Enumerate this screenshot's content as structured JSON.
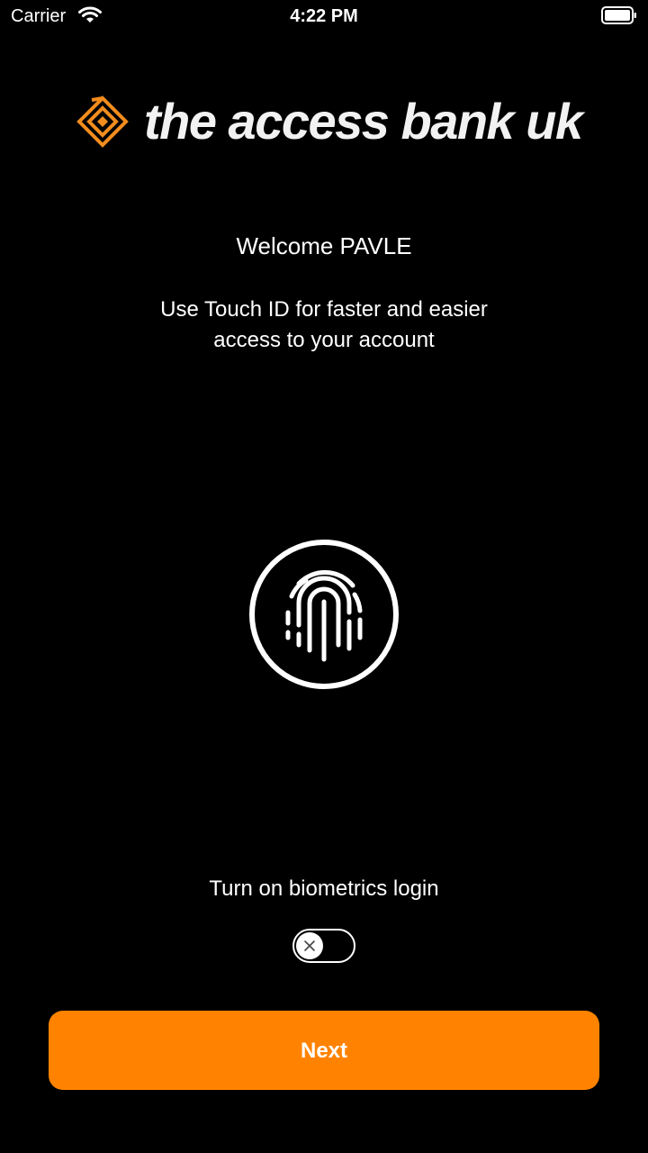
{
  "status_bar": {
    "carrier": "Carrier",
    "time": "4:22 PM",
    "wifi_icon": "wifi-icon",
    "battery_icon": "battery-full-icon"
  },
  "logo": {
    "text": "the access bank uk",
    "mark_color": "#f28c1e",
    "text_color": "#f2f2f2"
  },
  "welcome": "Welcome PAVLE",
  "subtitle": "Use Touch ID for faster and easier access to your account",
  "fingerprint_icon": "fingerprint-icon",
  "biometrics": {
    "label": "Turn on biometrics login",
    "enabled": false
  },
  "next_button": {
    "label": "Next",
    "color": "#ff8300"
  }
}
